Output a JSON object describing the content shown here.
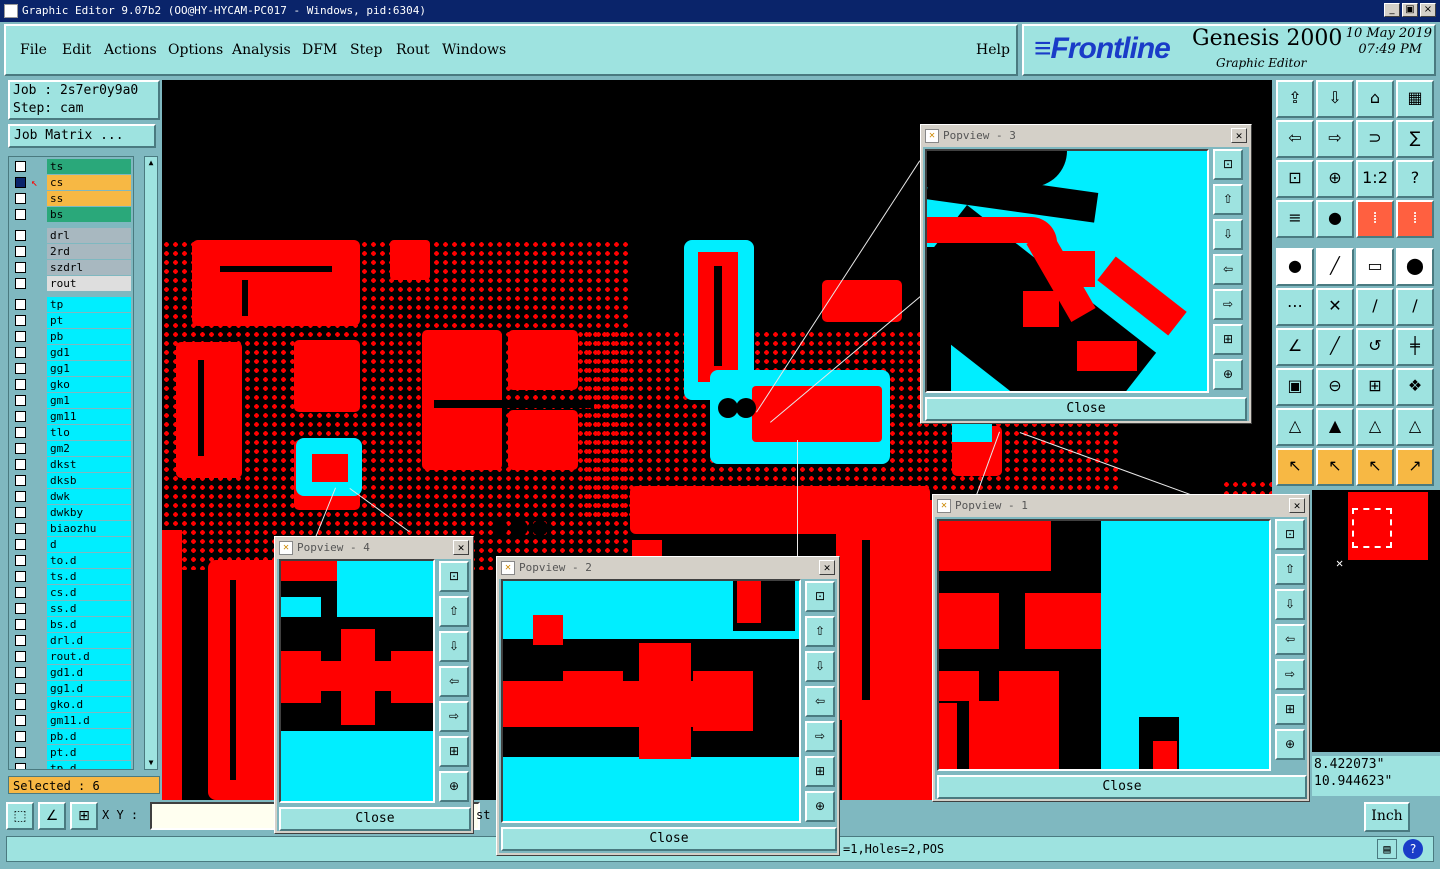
{
  "window": {
    "title": "Graphic Editor 9.07b2 (OO@HY-HYCAM-PC017 - Windows, pid:6304)",
    "min": "_",
    "max": "▣",
    "close": "×"
  },
  "menu": {
    "file": "File",
    "edit": "Edit",
    "actions": "Actions",
    "options": "Options",
    "analysis": "Analysis",
    "dfm": "DFM",
    "step": "Step",
    "rout": "Rout",
    "windows": "Windows",
    "help": "Help"
  },
  "brand": {
    "logo": "≡Frontline",
    "product": "Genesis 2000",
    "subtitle": "Graphic Editor",
    "date": "10 May 2019",
    "time": "07:49 PM"
  },
  "job": {
    "job_line": "Job : 2s7er0y9a0",
    "step_line": "Step: cam",
    "matrix_button": "Job Matrix ..."
  },
  "layers": [
    {
      "name": "ts",
      "color": "green"
    },
    {
      "name": "cs",
      "color": "orange",
      "active": true
    },
    {
      "name": "ss",
      "color": "orange"
    },
    {
      "name": "bs",
      "color": "green"
    },
    {
      "name": "drl",
      "color": "gray"
    },
    {
      "name": "2rd",
      "color": "gray"
    },
    {
      "name": "szdrl",
      "color": "gray"
    },
    {
      "name": "rout",
      "color": "light"
    },
    {
      "name": "tp",
      "color": "cyan"
    },
    {
      "name": "pt",
      "color": "cyan"
    },
    {
      "name": "pb",
      "color": "cyan"
    },
    {
      "name": "gd1",
      "color": "cyan"
    },
    {
      "name": "gg1",
      "color": "cyan"
    },
    {
      "name": "gko",
      "color": "cyan"
    },
    {
      "name": "gm1",
      "color": "cyan"
    },
    {
      "name": "gm11",
      "color": "cyan"
    },
    {
      "name": "tlo",
      "color": "cyan"
    },
    {
      "name": "gm2",
      "color": "cyan"
    },
    {
      "name": "dkst",
      "color": "cyan"
    },
    {
      "name": "dksb",
      "color": "cyan"
    },
    {
      "name": "dwk",
      "color": "cyan"
    },
    {
      "name": "dwkby",
      "color": "cyan"
    },
    {
      "name": "biaozhu",
      "color": "cyan"
    },
    {
      "name": "d",
      "color": "cyan"
    },
    {
      "name": "to.d",
      "color": "cyan"
    },
    {
      "name": "ts.d",
      "color": "cyan"
    },
    {
      "name": "cs.d",
      "color": "cyan"
    },
    {
      "name": "ss.d",
      "color": "cyan"
    },
    {
      "name": "bs.d",
      "color": "cyan"
    },
    {
      "name": "drl.d",
      "color": "cyan"
    },
    {
      "name": "rout.d",
      "color": "cyan"
    },
    {
      "name": "gd1.d",
      "color": "cyan"
    },
    {
      "name": "gg1.d",
      "color": "cyan"
    },
    {
      "name": "gko.d",
      "color": "cyan"
    },
    {
      "name": "gm11.d",
      "color": "cyan"
    },
    {
      "name": "pb.d",
      "color": "cyan"
    },
    {
      "name": "pt.d",
      "color": "cyan"
    },
    {
      "name": "tp.d",
      "color": "cyan"
    }
  ],
  "selected": "Selected : 6",
  "coords": {
    "x": "8.422073\"",
    "y": "10.944623\""
  },
  "bottom": {
    "xy_label": "X Y :",
    "xy_value": "",
    "status": "=1,Holes=2,POS",
    "status_prefix": "st",
    "units": "Inch"
  },
  "popups": {
    "p1": {
      "title": "Popview - 1",
      "close": "Close"
    },
    "p2": {
      "title": "Popview - 2",
      "close": "Close"
    },
    "p3": {
      "title": "Popview - 3",
      "close": "Close"
    },
    "p4": {
      "title": "Popview - 4",
      "close": "Close"
    }
  },
  "colors": {
    "copper": "#ff0000",
    "selected": "#00eeff",
    "background": "#000000",
    "panel": "#9ee3e0",
    "title": "#0a246a"
  }
}
